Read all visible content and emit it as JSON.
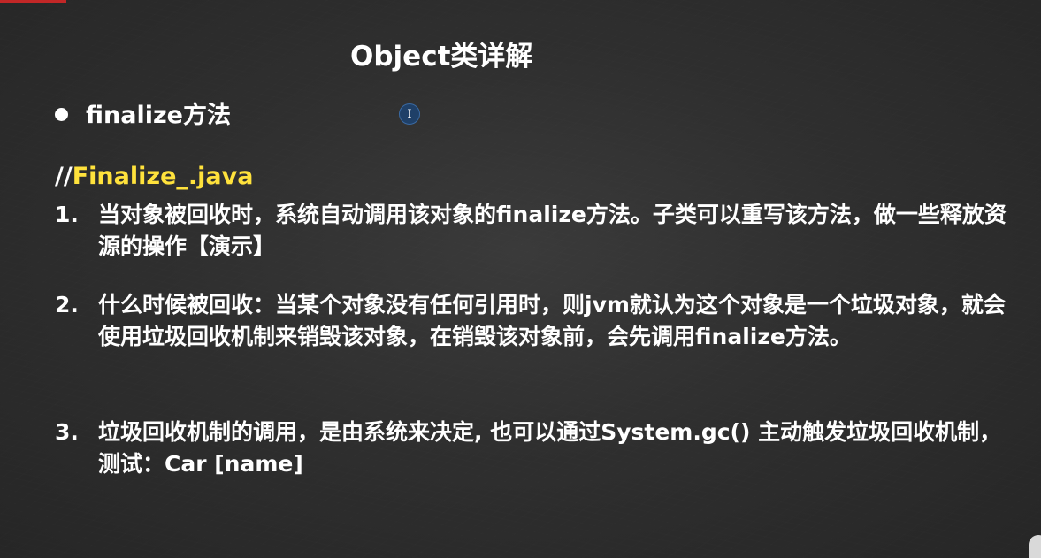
{
  "slide": {
    "title": "Object类详解",
    "bullet": "finalize方法",
    "file": {
      "prefix": "//",
      "name": "Finalize_.java"
    },
    "items": [
      {
        "number": "1.",
        "text": "当对象被回收时，系统自动调用该对象的finalize方法。子类可以重写该方法，做一些释放资源的操作【演示】"
      },
      {
        "number": "2.",
        "text": "什么时候被回收：当某个对象没有任何引用时，则jvm就认为这个对象是一个垃圾对象，就会使用垃圾回收机制来销毁该对象，在销毁该对象前，会先调用finalize方法。"
      },
      {
        "number": "3.",
        "text": "垃圾回收机制的调用，是由系统来决定, 也可以通过System.gc() 主动触发垃圾回收机制，测试：Car [name]"
      }
    ],
    "cursor_label": "I",
    "colors": {
      "background": "#2b2b2b",
      "text": "#ffffff",
      "highlight": "#ffe23c"
    },
    "icons": {
      "bullet": "bullet-dot-icon",
      "cursor": "text-cursor-icon"
    }
  }
}
